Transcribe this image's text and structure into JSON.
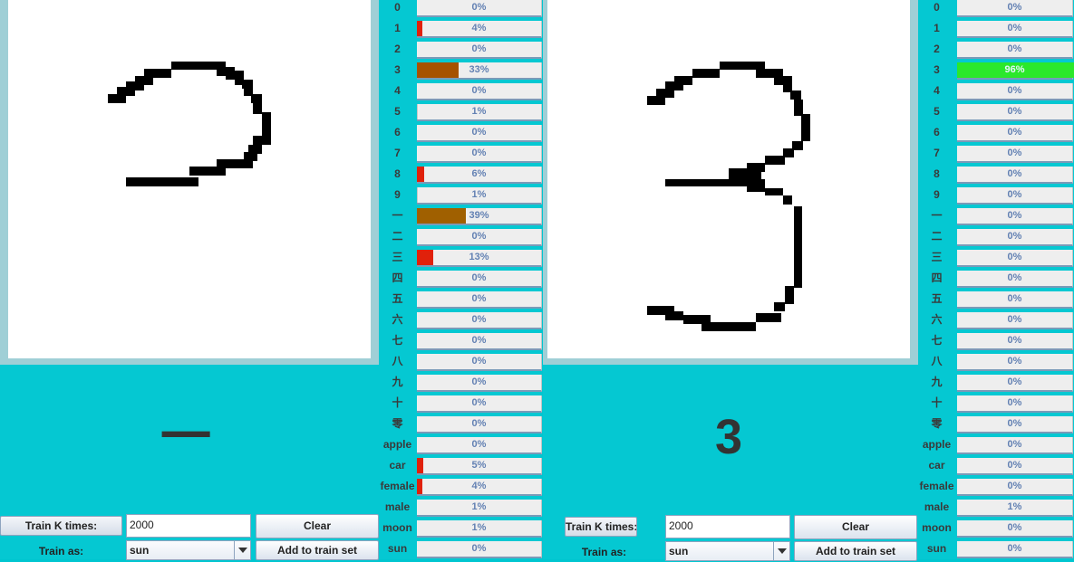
{
  "classes": [
    "0",
    "1",
    "2",
    "3",
    "4",
    "5",
    "6",
    "7",
    "8",
    "9",
    "一",
    "二",
    "三",
    "四",
    "五",
    "六",
    "七",
    "八",
    "九",
    "十",
    "零",
    "apple",
    "car",
    "female",
    "male",
    "moon",
    "sun"
  ],
  "colors": {
    "background": "#05c8d2",
    "canvas": "#ffffff",
    "bar_track": "#eeeeee",
    "bar_border": "#7a9ab8",
    "percent_text": "#6381b3",
    "bar_red": "#e0210b",
    "bar_brown_dark": "#a65200",
    "bar_brown": "#a06000",
    "bar_green": "#2be82b"
  },
  "panels": [
    {
      "id": "left",
      "prediction": "一",
      "scores": [
        {
          "label": "0",
          "percent": "0%",
          "value": 0,
          "color": ""
        },
        {
          "label": "1",
          "percent": "4%",
          "value": 0.04,
          "color": "#e0210b"
        },
        {
          "label": "2",
          "percent": "0%",
          "value": 0,
          "color": ""
        },
        {
          "label": "3",
          "percent": "33%",
          "value": 0.33,
          "color": "#a65200"
        },
        {
          "label": "4",
          "percent": "0%",
          "value": 0,
          "color": ""
        },
        {
          "label": "5",
          "percent": "1%",
          "value": 0.01,
          "color": "#c8c8c8"
        },
        {
          "label": "6",
          "percent": "0%",
          "value": 0,
          "color": ""
        },
        {
          "label": "7",
          "percent": "0%",
          "value": 0,
          "color": ""
        },
        {
          "label": "8",
          "percent": "6%",
          "value": 0.06,
          "color": "#e0210b"
        },
        {
          "label": "9",
          "percent": "1%",
          "value": 0.01,
          "color": "#c8c8c8"
        },
        {
          "label": "一",
          "percent": "39%",
          "value": 0.39,
          "color": "#a06000"
        },
        {
          "label": "二",
          "percent": "0%",
          "value": 0,
          "color": ""
        },
        {
          "label": "三",
          "percent": "13%",
          "value": 0.13,
          "color": "#e0210b"
        },
        {
          "label": "四",
          "percent": "0%",
          "value": 0,
          "color": ""
        },
        {
          "label": "五",
          "percent": "0%",
          "value": 0,
          "color": ""
        },
        {
          "label": "六",
          "percent": "0%",
          "value": 0,
          "color": ""
        },
        {
          "label": "七",
          "percent": "0%",
          "value": 0,
          "color": ""
        },
        {
          "label": "八",
          "percent": "0%",
          "value": 0,
          "color": ""
        },
        {
          "label": "九",
          "percent": "0%",
          "value": 0,
          "color": ""
        },
        {
          "label": "十",
          "percent": "0%",
          "value": 0,
          "color": ""
        },
        {
          "label": "零",
          "percent": "0%",
          "value": 0,
          "color": ""
        },
        {
          "label": "apple",
          "percent": "0%",
          "value": 0,
          "color": ""
        },
        {
          "label": "car",
          "percent": "5%",
          "value": 0.05,
          "color": "#e0210b"
        },
        {
          "label": "female",
          "percent": "4%",
          "value": 0.04,
          "color": "#e0210b"
        },
        {
          "label": "male",
          "percent": "1%",
          "value": 0.01,
          "color": ""
        },
        {
          "label": "moon",
          "percent": "1%",
          "value": 0.01,
          "color": ""
        },
        {
          "label": "sun",
          "percent": "0%",
          "value": 0,
          "color": ""
        }
      ],
      "controls": {
        "train_k_times_label": "Train K times:",
        "train_k_value": "2000",
        "clear_label": "Clear",
        "train_as_label": "Train as:",
        "train_as_value": "sun",
        "add_to_train_set_label": "Add to train set"
      }
    },
    {
      "id": "right",
      "prediction": "3",
      "scores": [
        {
          "label": "0",
          "percent": "0%",
          "value": 0,
          "color": ""
        },
        {
          "label": "1",
          "percent": "0%",
          "value": 0,
          "color": ""
        },
        {
          "label": "2",
          "percent": "0%",
          "value": 0,
          "color": ""
        },
        {
          "label": "3",
          "percent": "96%",
          "value": 0.96,
          "color": "#2be82b"
        },
        {
          "label": "4",
          "percent": "0%",
          "value": 0,
          "color": ""
        },
        {
          "label": "5",
          "percent": "0%",
          "value": 0,
          "color": ""
        },
        {
          "label": "6",
          "percent": "0%",
          "value": 0,
          "color": ""
        },
        {
          "label": "7",
          "percent": "0%",
          "value": 0,
          "color": ""
        },
        {
          "label": "8",
          "percent": "0%",
          "value": 0,
          "color": ""
        },
        {
          "label": "9",
          "percent": "0%",
          "value": 0,
          "color": ""
        },
        {
          "label": "一",
          "percent": "0%",
          "value": 0,
          "color": ""
        },
        {
          "label": "二",
          "percent": "0%",
          "value": 0,
          "color": ""
        },
        {
          "label": "三",
          "percent": "0%",
          "value": 0,
          "color": ""
        },
        {
          "label": "四",
          "percent": "0%",
          "value": 0,
          "color": ""
        },
        {
          "label": "五",
          "percent": "0%",
          "value": 0,
          "color": ""
        },
        {
          "label": "六",
          "percent": "0%",
          "value": 0,
          "color": ""
        },
        {
          "label": "七",
          "percent": "0%",
          "value": 0,
          "color": ""
        },
        {
          "label": "八",
          "percent": "0%",
          "value": 0,
          "color": ""
        },
        {
          "label": "九",
          "percent": "0%",
          "value": 0,
          "color": ""
        },
        {
          "label": "十",
          "percent": "0%",
          "value": 0,
          "color": ""
        },
        {
          "label": "零",
          "percent": "0%",
          "value": 0,
          "color": ""
        },
        {
          "label": "apple",
          "percent": "0%",
          "value": 0,
          "color": ""
        },
        {
          "label": "car",
          "percent": "0%",
          "value": 0,
          "color": ""
        },
        {
          "label": "female",
          "percent": "0%",
          "value": 0,
          "color": ""
        },
        {
          "label": "male",
          "percent": "1%",
          "value": 0.01,
          "color": ""
        },
        {
          "label": "moon",
          "percent": "0%",
          "value": 0,
          "color": ""
        },
        {
          "label": "sun",
          "percent": "0%",
          "value": 0,
          "color": ""
        }
      ],
      "controls": {
        "train_k_times_label": "Train K times:",
        "train_k_value": "2000",
        "clear_label": "Clear",
        "train_as_label": "Train as:",
        "train_as_value": "sun",
        "add_to_train_set_label": "Add to train set"
      }
    }
  ]
}
